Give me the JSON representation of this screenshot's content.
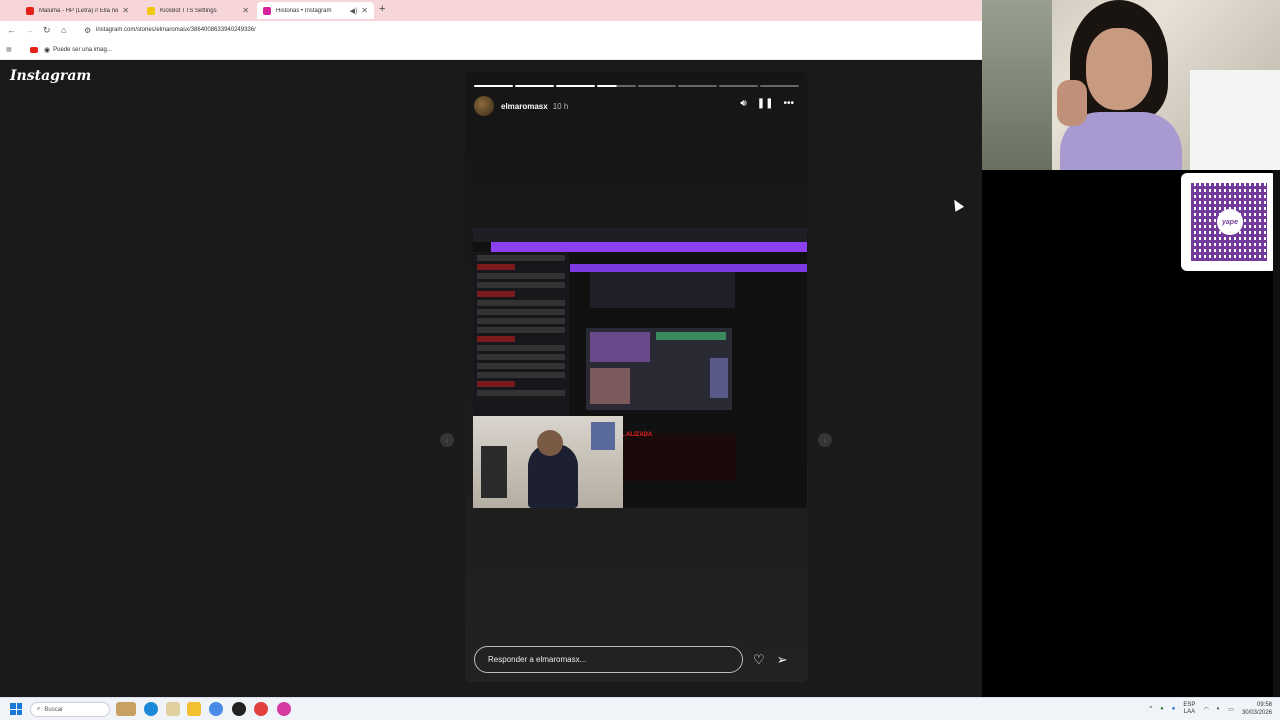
{
  "browser": {
    "tabs": [
      {
        "title": "Maluma - HP (Letra) // Ella no e",
        "favicon_color": "#e62117",
        "active": false
      },
      {
        "title": "KickBot TTS Settings",
        "favicon_color": "#f2c811",
        "active": false
      },
      {
        "title": "Historias • Instagram",
        "favicon_color": "#d6249f",
        "active": true
      }
    ],
    "url": "instagram.com/stories/elmaromasx/3864008633940249336/",
    "bookmark_label": "Puede ser una imag..."
  },
  "instagram": {
    "logo": "Instagram",
    "story": {
      "username": "elmaromasx",
      "time_ago": "10 h",
      "progress_segments": 8,
      "completed_segments": 3,
      "media_overlay_text": "...ALIZADA"
    },
    "reply_placeholder": "Responder a elmaromasx..."
  },
  "qr_badge": "yape",
  "taskbar": {
    "search_placeholder": "Buscar",
    "language_top": "ESP",
    "language_bottom": "LAA",
    "time": "09:58",
    "date": "30/03/2026"
  }
}
